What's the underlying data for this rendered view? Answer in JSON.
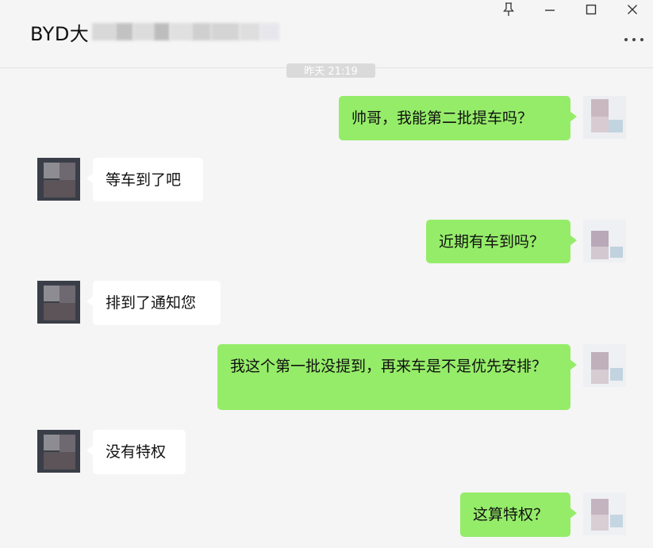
{
  "window": {
    "title": "BYD大",
    "controls": [
      "pin-icon",
      "minimize-icon",
      "maximize-icon",
      "close-icon"
    ],
    "more_icon": "more-dots-icon"
  },
  "timestamp": "昨天 21:19",
  "messages": [
    {
      "from": "me",
      "text": "帅哥，我能第二批提车吗？"
    },
    {
      "from": "other",
      "text": "等车到了吧"
    },
    {
      "from": "me",
      "text": "近期有车到吗？"
    },
    {
      "from": "other",
      "text": "排到了通知您"
    },
    {
      "from": "me",
      "text": "我这个第一批没提到，再来车是不是优先安排？"
    },
    {
      "from": "other",
      "text": "没有特权"
    },
    {
      "from": "me",
      "text": "这算特权？"
    }
  ],
  "colors": {
    "my_bubble": "#95ec69",
    "other_bubble": "#ffffff",
    "background": "#f5f5f5"
  }
}
